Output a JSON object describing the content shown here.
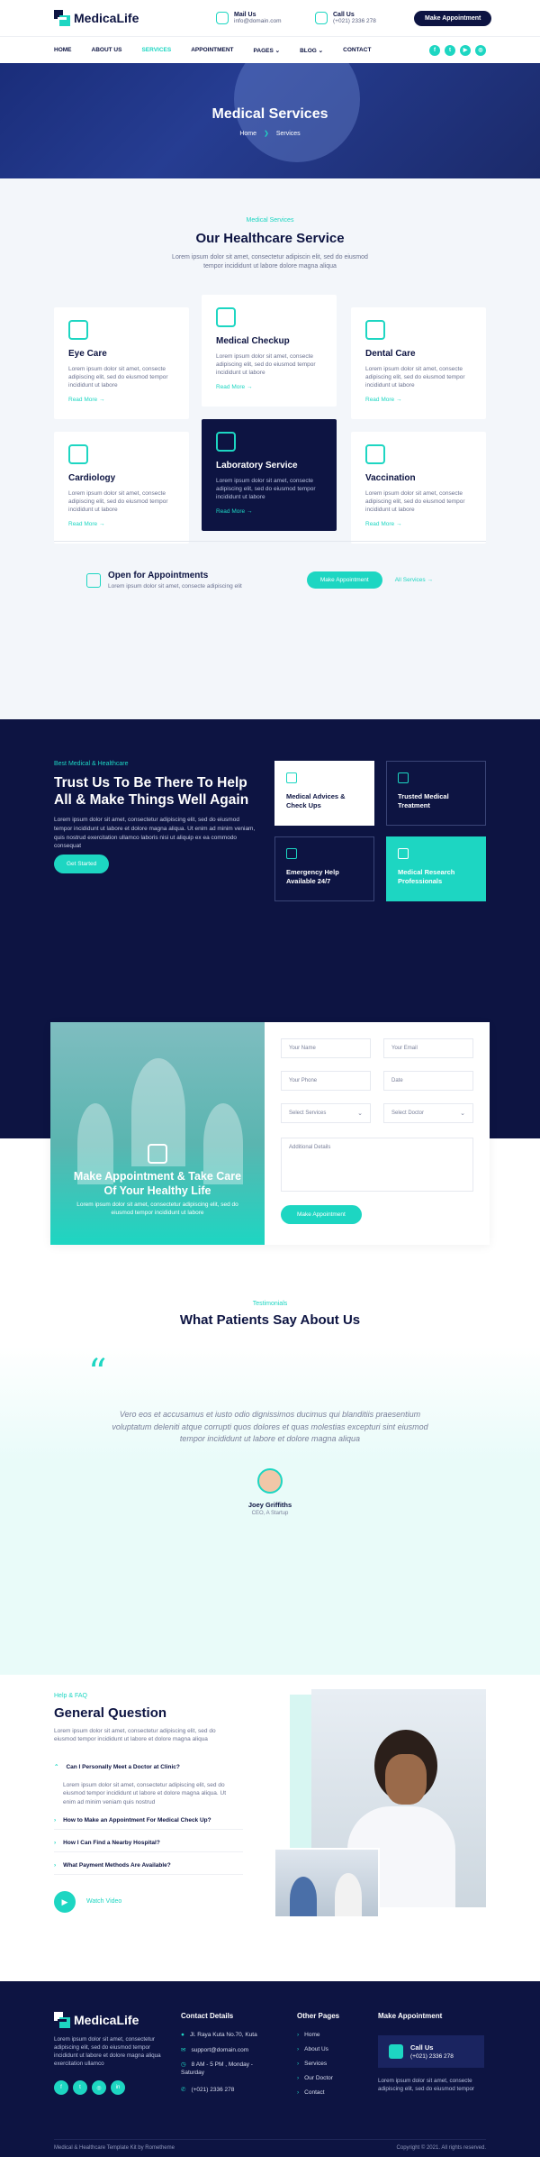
{
  "brand": {
    "name": "MedicaLife"
  },
  "header": {
    "mail_label": "Mail Us",
    "mail_value": "info@domain.com",
    "call_label": "Call Us",
    "call_value": "(+021) 2336 278",
    "cta": "Make Appointment"
  },
  "nav": {
    "items": [
      "HOME",
      "ABOUT US",
      "SERVICES",
      "APPOINTMENT",
      "PAGES",
      "BLOG",
      "CONTACT"
    ],
    "active": "SERVICES"
  },
  "hero": {
    "title": "Medical Services",
    "crumb_home": "Home",
    "crumb_sep": "❯",
    "crumb_current": "Services"
  },
  "services": {
    "eyebrow": "Medical Services",
    "title": "Our Healthcare Service",
    "subtitle": "Lorem ipsum dolor sit amet, consectetur adipiscin elit, sed do eiusmod tempor incididunt ut labore dolore magna aliqua",
    "cards": [
      {
        "title": "Eye Care",
        "text": "Lorem ipsum dolor sit amet, consecte adipiscing elit, sed do eiusmod tempor incididunt ut labore",
        "more": "Read More →",
        "icon": "eye-care-icon"
      },
      {
        "title": "Medical Checkup",
        "text": "Lorem ipsum dolor sit amet, consecte adipiscing elit, sed do eiusmod tempor incididunt ut labore",
        "more": "Read More →",
        "icon": "doctor-icon"
      },
      {
        "title": "Dental Care",
        "text": "Lorem ipsum dolor sit amet, consecte adipiscing elit, sed do eiusmod tempor incididunt ut labore",
        "more": "Read More →",
        "icon": "tooth-icon"
      },
      {
        "title": "Cardiology",
        "text": "Lorem ipsum dolor sit amet, consecte adipiscing elit, sed do eiusmod tempor incididunt ut labore",
        "more": "Read More →",
        "icon": "heart-icon"
      },
      {
        "title": "Laboratory Service",
        "text": "Lorem ipsum dolor sit amet, consecte adipiscing elit, sed do eiusmod tempor incididunt ut labore",
        "more": "Read More →",
        "icon": "lab-icon"
      },
      {
        "title": "Vaccination",
        "text": "Lorem ipsum dolor sit amet, consecte adipiscing elit, sed do eiusmod tempor incididunt ut labore",
        "more": "Read More →",
        "icon": "syringe-icon"
      }
    ],
    "appointment": {
      "title": "Open for Appointments",
      "text": "Lorem ipsum dolor sit amet, consecte adipiscing elit",
      "btn": "Make Appointment",
      "link": "All Services →"
    }
  },
  "trust": {
    "eyebrow": "Best Medical & Healthcare",
    "title": "Trust Us To Be There To Help All & Make Things Well Again",
    "text": "Lorem ipsum dolor sit amet, consectetur adipiscing elit, sed do eiusmod tempor incididunt ut labore et dolore magna aliqua. Ut enim ad minim veniam, quis nostrud exercitation ullamco laboris nisi ut aliquip ex ea commodo consequat",
    "btn": "Get Started",
    "features": [
      {
        "title": "Medical Advices & Check Ups"
      },
      {
        "title": "Trusted Medical Treatment"
      },
      {
        "title": "Emergency Help Available 24/7"
      },
      {
        "title": "Medical Research Professionals"
      }
    ]
  },
  "form": {
    "title": "Make Appointment & Take Care Of Your Healthy Life",
    "text": "Lorem ipsum dolor sit amet, consectetur adipiscing elit, sed do eiusmod tempor incididunt ut labore",
    "fields": {
      "name": "Your Name",
      "email": "Your Email",
      "phone": "Your Phone",
      "date": "Date",
      "service": "Select Services",
      "doctor": "Select Doctor",
      "details": "Additional Details"
    },
    "submit": "Make Appointment"
  },
  "testimonials": {
    "eyebrow": "Testimonials",
    "title": "What Patients Say About Us",
    "quote": "Vero eos et accusamus et iusto odio dignissimos ducimus qui blanditiis praesentium voluptatum deleniti atque corrupti quos dolores et quas molestias excepturi sint eiusmod tempor incididunt ut labore et dolore magna aliqua",
    "name": "Joey Griffiths",
    "role": "CEO, A Startup"
  },
  "faq": {
    "eyebrow": "Help & FAQ",
    "title": "General Question",
    "text": "Lorem ipsum dolor sit amet, consectetur adipiscing elit, sed do eiusmod tempor incididunt ut labore et dolore magna aliqua",
    "q1": "Can I Personally Meet a Doctor at Clinic?",
    "a1": "Lorem ipsum dolor sit amet, consectetur adipiscing elit, sed do eiusmod tempor incididunt ut labore et dolore magna aliqua. Ut enim ad minim veniam quis nostrud",
    "q2": "How to Make an Appointment For Medical Check Up?",
    "q3": "How I Can Find a Nearby Hospital?",
    "q4": "What Payment Methods Are Available?",
    "video": "Watch Video"
  },
  "footer": {
    "about": "Lorem ipsum dolor sit amet, consectetur adipiscing elit, sed do eiusmod tempor incididunt ut labore et dolore magna aliqua exercitation ullamco",
    "contact_title": "Contact Details",
    "address": "Jl. Raya Kuta No.70, Kuta",
    "email": "support@domain.com",
    "hours": "8 AM - 5 PM , Monday - Saturday",
    "phone": "(+021) 2336 278",
    "pages_title": "Other Pages",
    "pages": [
      "Home",
      "About Us",
      "Services",
      "Our Doctor",
      "Contact"
    ],
    "appt_title": "Make Appointment",
    "call_label": "Call Us",
    "call_value": "(+021) 2336 278",
    "appt_text": "Lorem ipsum dolor sit amet, consecte adipiscing elit, sed do eiusmod tempor",
    "copyright_left": "Medical & Healthcare Template Kit by Rometheme",
    "copyright_right": "Copyright © 2021. All rights reserved."
  },
  "colors": {
    "navy": "#0d1442",
    "teal": "#1dd6c2"
  }
}
